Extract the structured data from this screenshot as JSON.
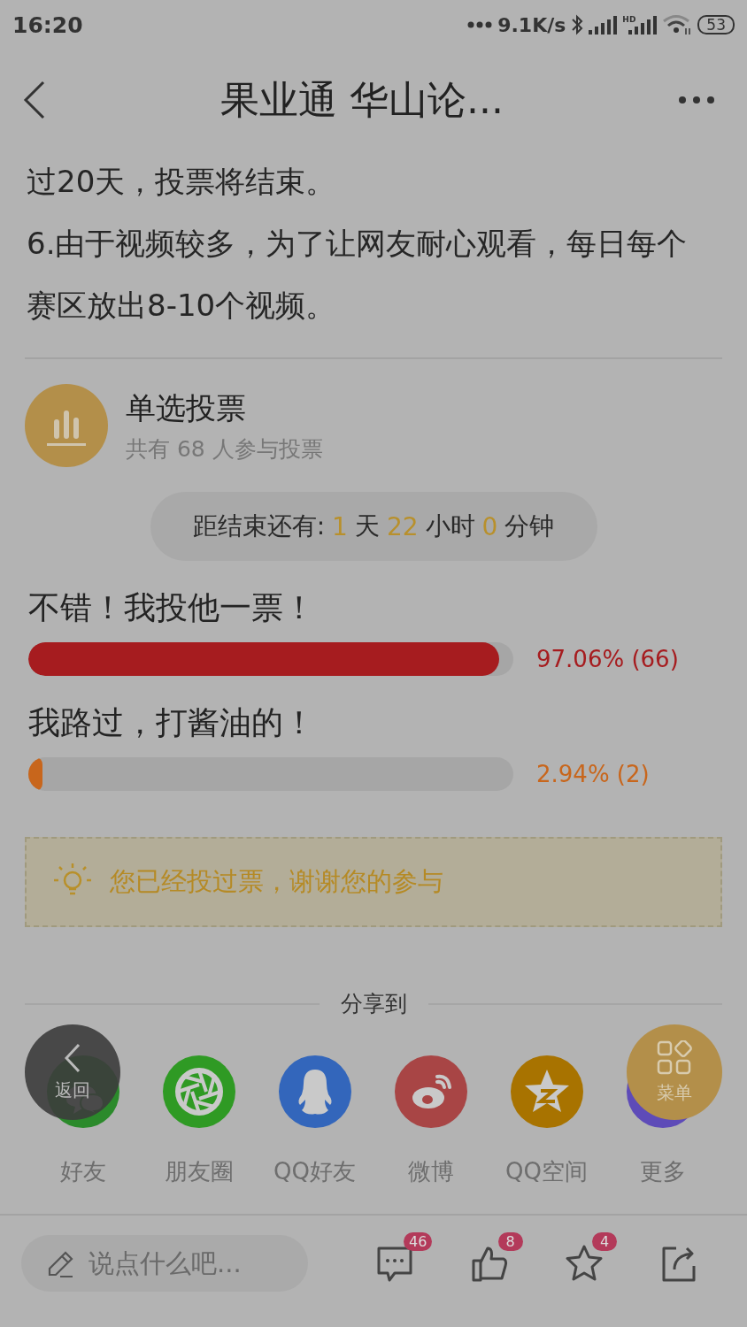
{
  "status_bar": {
    "time": "16:20",
    "net_speed": "9.1K/s",
    "hd": "HD",
    "battery": "53"
  },
  "nav": {
    "title": "果业通 华山论..."
  },
  "paragraphs": [
    "过20天，投票将结束。",
    "6.由于视频较多，为了让网友耐心观看，每日每个赛区放出8-10个视频。"
  ],
  "poll": {
    "title": "单选投票",
    "subtitle": "共有 68 人参与投票",
    "countdown": [
      {
        "text": "距结束还有:",
        "kind": "label"
      },
      {
        "text": "1",
        "kind": "number"
      },
      {
        "text": "天",
        "kind": "label"
      },
      {
        "text": "22",
        "kind": "number"
      },
      {
        "text": "小时",
        "kind": "label"
      },
      {
        "text": "0",
        "kind": "number"
      },
      {
        "text": "分钟",
        "kind": "label"
      }
    ],
    "options": [
      {
        "label": "不错！我投他一票！",
        "level": 0.9706,
        "result": "97.06% (66)",
        "color": "#a61c1f"
      },
      {
        "label": "我路过，打酱油的！",
        "level": 0.0294,
        "result": "2.94% (2)",
        "color": "#c8661c"
      }
    ],
    "notice": "您已经投过票，谢谢您的参与"
  },
  "share": {
    "heading": "分享到",
    "items": [
      {
        "kind": "wechat",
        "label": "好友",
        "color": "#2b8a2b"
      },
      {
        "kind": "moments",
        "label": "朋友圈",
        "color": "#2f9a24"
      },
      {
        "kind": "qq",
        "label": "QQ好友",
        "color": "#3366bb"
      },
      {
        "kind": "weibo",
        "label": "微博",
        "color": "#a84545"
      },
      {
        "kind": "qzone",
        "label": "QQ空间",
        "color": "#a87300"
      },
      {
        "kind": "more",
        "label": "更多",
        "color": "#5e4bb8"
      }
    ]
  },
  "floating": {
    "back": "返回",
    "menu": "菜单"
  },
  "bottom_bar": {
    "placeholder": "说点什么吧...",
    "comments": "46",
    "likes": "8",
    "favorites": "4"
  }
}
